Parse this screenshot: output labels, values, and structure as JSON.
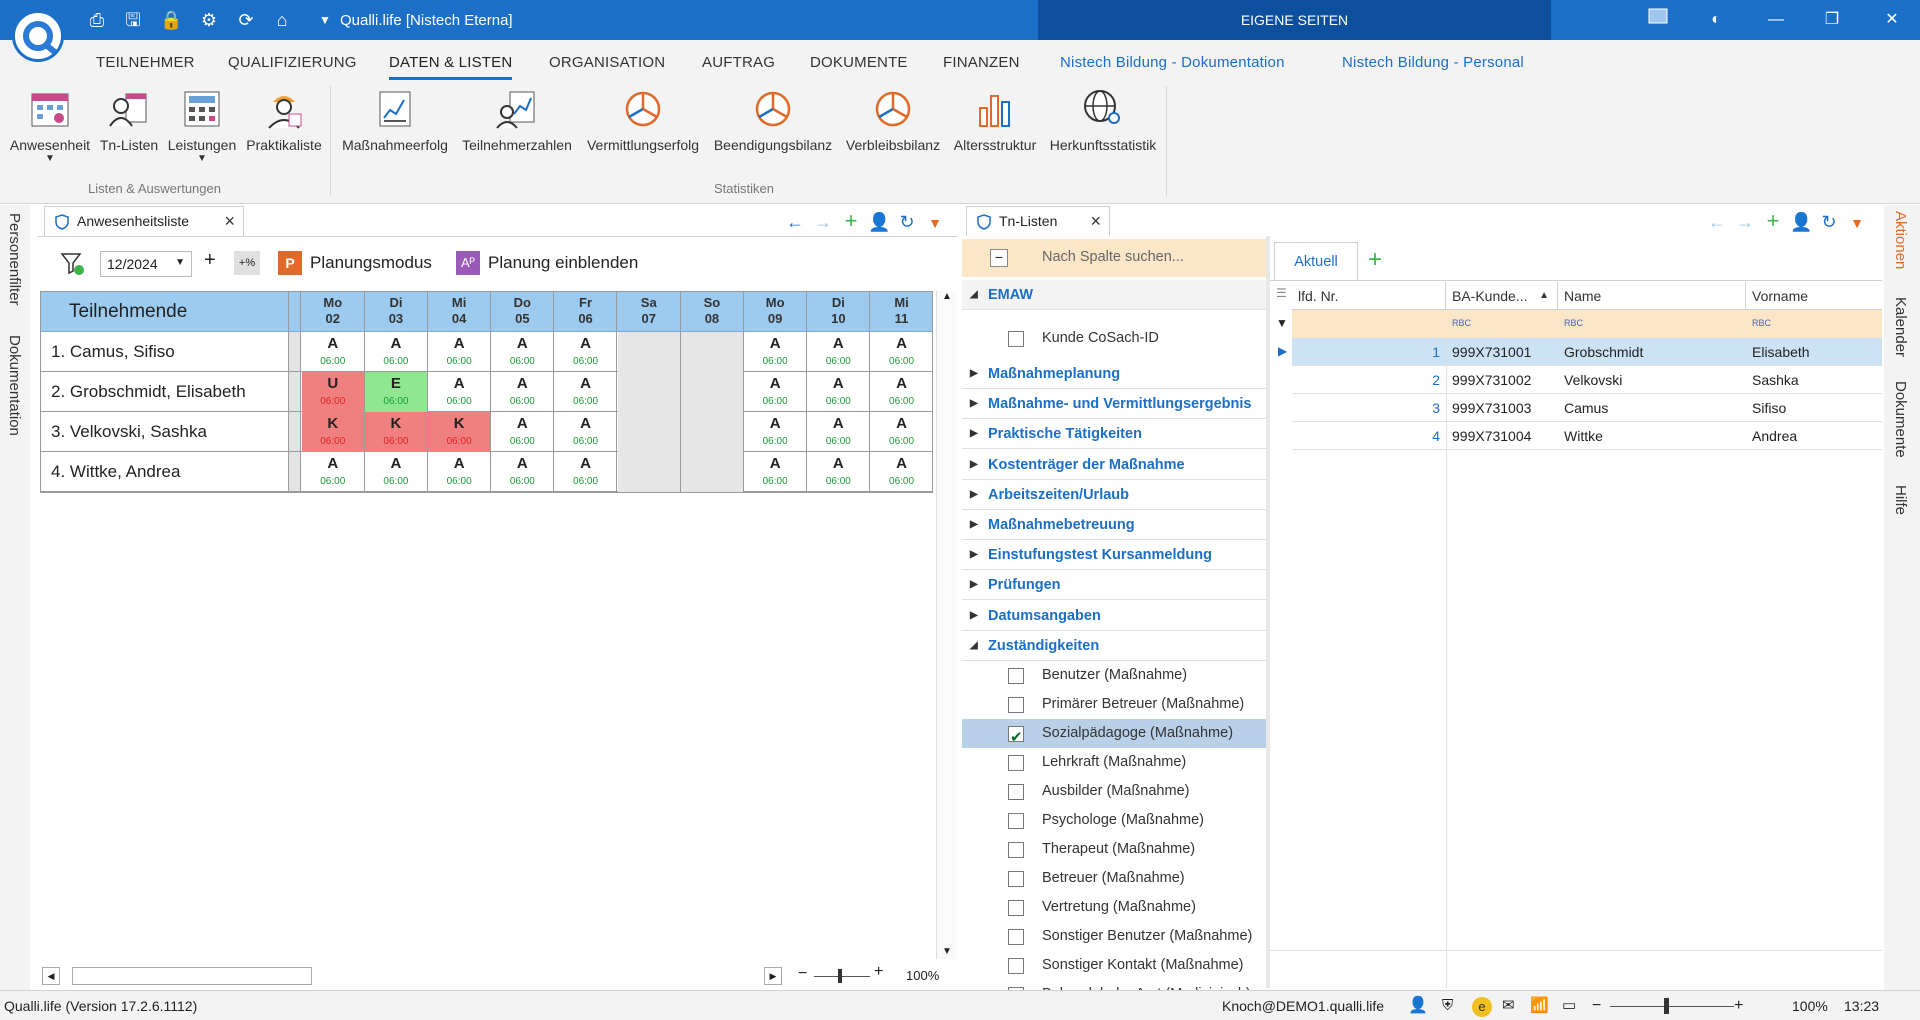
{
  "window": {
    "title": "Qualli.life [Nistech Eterna]",
    "eigene_seiten": "EIGENE SEITEN"
  },
  "ribbon_tabs": [
    {
      "label": "TEILNEHMER"
    },
    {
      "label": "QUALIFIZIERUNG"
    },
    {
      "label": "DATEN & LISTEN"
    },
    {
      "label": "ORGANISATION"
    },
    {
      "label": "AUFTRAG"
    },
    {
      "label": "DOKUMENTE"
    },
    {
      "label": "FINANZEN"
    },
    {
      "label": "Nistech Bildung - Dokumentation"
    },
    {
      "label": "Nistech Bildung - Personal"
    }
  ],
  "ribbon": {
    "listen": [
      "Anwesenheit",
      "Tn-Listen",
      "Leistungen",
      "Praktikaliste"
    ],
    "listen_group": "Listen & Auswertungen",
    "statistiken": [
      "Maßnahmeerfolg",
      "Teilnehmerzahlen",
      "Vermittlungserfolg",
      "Beendigungsbilanz",
      "Verbleibsbilanz",
      "Altersstruktur",
      "Herkunftsstatistik"
    ],
    "statistiken_group": "Statistiken"
  },
  "left_strip": [
    "Personenfilter",
    "Dokumentation"
  ],
  "right_strip": [
    "Aktionen",
    "Kalender",
    "Dokumente",
    "Hilfe"
  ],
  "attendance": {
    "tab": "Anwesenheitsliste",
    "month": "12/2024",
    "percent_btn": "+%",
    "planungsmodus": "Planungsmodus",
    "planung_einblenden": "Planung einblenden",
    "header": "Teilnehmende",
    "days": [
      {
        "wd": "Mo",
        "d": "02",
        "weekend": false
      },
      {
        "wd": "Di",
        "d": "03",
        "weekend": false
      },
      {
        "wd": "Mi",
        "d": "04",
        "weekend": false
      },
      {
        "wd": "Do",
        "d": "05",
        "weekend": false
      },
      {
        "wd": "Fr",
        "d": "06",
        "weekend": false
      },
      {
        "wd": "Sa",
        "d": "07",
        "weekend": true
      },
      {
        "wd": "So",
        "d": "08",
        "weekend": true
      },
      {
        "wd": "Mo",
        "d": "09",
        "weekend": false
      },
      {
        "wd": "Di",
        "d": "10",
        "weekend": false
      },
      {
        "wd": "Mi",
        "d": "11",
        "weekend": false
      }
    ],
    "rows": [
      {
        "name": "1. Camus, Sifiso",
        "cells": [
          "A",
          "A",
          "A",
          "A",
          "A",
          "",
          "",
          "A",
          "A",
          "A"
        ],
        "colors": [
          "",
          "",
          "",
          "",
          "",
          "",
          "",
          "",
          "",
          ""
        ]
      },
      {
        "name": "2. Grobschmidt, Elisabeth",
        "cells": [
          "U",
          "E",
          "A",
          "A",
          "A",
          "",
          "",
          "A",
          "A",
          "A"
        ],
        "colors": [
          "#f08080",
          "#8fe88f",
          "",
          "",
          "",
          "",
          "",
          "",
          "",
          ""
        ]
      },
      {
        "name": "3. Velkovski, Sashka",
        "cells": [
          "K",
          "K",
          "K",
          "A",
          "A",
          "",
          "",
          "A",
          "A",
          "A"
        ],
        "colors": [
          "#f08080",
          "#f08080",
          "#f08080",
          "",
          "",
          "",
          "",
          "",
          "",
          ""
        ]
      },
      {
        "name": "4. Wittke, Andrea",
        "cells": [
          "A",
          "A",
          "A",
          "A",
          "A",
          "",
          "",
          "A",
          "A",
          "A"
        ],
        "colors": [
          "",
          "",
          "",
          "",
          "",
          "",
          "",
          "",
          "",
          ""
        ]
      }
    ],
    "time": "06:00",
    "zoom": "100%"
  },
  "tnlisten": {
    "tab": "Tn-Listen",
    "search_placeholder": "Nach Spalte suchen...",
    "groups": [
      {
        "label": "EMAW",
        "open": true
      },
      {
        "label": "Maßnahmeplanung"
      },
      {
        "label": "Maßnahme- und Vermittlungsergebnis"
      },
      {
        "label": "Praktische Tätigkeiten"
      },
      {
        "label": "Kostenträger der Maßnahme"
      },
      {
        "label": "Arbeitszeiten/Urlaub"
      },
      {
        "label": "Maßnahmebetreuung"
      },
      {
        "label": "Einstufungstest Kursanmeldung"
      },
      {
        "label": "Prüfungen"
      },
      {
        "label": "Datumsangaben"
      },
      {
        "label": "Zuständigkeiten",
        "open": true
      }
    ],
    "emaw_item": "Kunde CoSach-ID",
    "zust_items": [
      {
        "label": "Benutzer (Maßnahme)",
        "checked": false
      },
      {
        "label": "Primärer Betreuer (Maßnahme)",
        "checked": false
      },
      {
        "label": "Sozialpädagoge (Maßnahme)",
        "checked": true
      },
      {
        "label": "Lehrkraft (Maßnahme)",
        "checked": false
      },
      {
        "label": "Ausbilder (Maßnahme)",
        "checked": false
      },
      {
        "label": "Psychologe (Maßnahme)",
        "checked": false
      },
      {
        "label": "Therapeut (Maßnahme)",
        "checked": false
      },
      {
        "label": "Betreuer (Maßnahme)",
        "checked": false
      },
      {
        "label": "Vertretung (Maßnahme)",
        "checked": false
      },
      {
        "label": "Sonstiger Benutzer (Maßnahme)",
        "checked": false
      },
      {
        "label": "Sonstiger Kontakt (Maßnahme)",
        "checked": false
      },
      {
        "label": "Behandelnder Arzt (Medizinisch)",
        "checked": false
      }
    ],
    "view_tab": "Aktuell",
    "columns": [
      "lfd. Nr.",
      "BA-Kunde...",
      "Name",
      "Vorname"
    ],
    "filter_tag": "RBC",
    "rows": [
      {
        "nr": "1",
        "ba": "999X731001",
        "name": "Grobschmidt",
        "vorname": "Elisabeth"
      },
      {
        "nr": "2",
        "ba": "999X731002",
        "name": "Velkovski",
        "vorname": "Sashka"
      },
      {
        "nr": "3",
        "ba": "999X731003",
        "name": "Camus",
        "vorname": "Sifiso"
      },
      {
        "nr": "4",
        "ba": "999X731004",
        "name": "Wittke",
        "vorname": "Andrea"
      }
    ]
  },
  "status": {
    "version": "Qualli.life (Version 17.2.6.1112)",
    "user": "Knoch@DEMO1.qualli.life",
    "zoom": "100%",
    "time": "13:23"
  },
  "colors": {
    "accent": "#1c6fc7",
    "header_blue": "#9ccbef",
    "absent_red": "#f08080",
    "green": "#8fe88f",
    "time_green": "#1a9a3a",
    "time_red": "#d22"
  }
}
